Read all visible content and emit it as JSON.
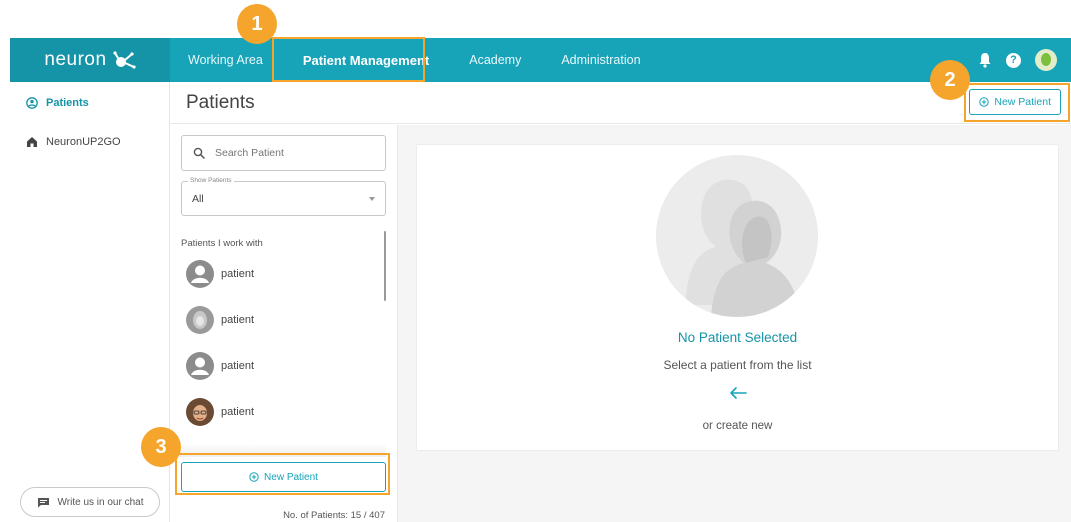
{
  "brand": {
    "logo_text": "neuron"
  },
  "nav": {
    "items": [
      "Working Area",
      "Patient Management",
      "Academy",
      "Administration"
    ],
    "active": "Patient Management"
  },
  "top_icons": [
    "bell-icon",
    "help-icon",
    "user-avatar"
  ],
  "help_glyph": "?",
  "sidebar": {
    "items": [
      {
        "label": "Patients",
        "icon": "user-circle-icon",
        "active": true
      },
      {
        "label": "NeuronUP2GO",
        "icon": "home-icon",
        "active": false
      }
    ],
    "chat_label": "Write us in our chat"
  },
  "header": {
    "title": "Patients",
    "new_patient_label": "New Patient"
  },
  "list": {
    "search_placeholder": "Search Patient",
    "filter_label": "Show Patients",
    "filter_value": "All",
    "heading": "Patients I work with",
    "patients": [
      {
        "name": "patient",
        "avatar": "default-avatar"
      },
      {
        "name": "patient",
        "avatar": "female-silhouette-avatar"
      },
      {
        "name": "patient",
        "avatar": "default-avatar"
      },
      {
        "name": "patient",
        "avatar": "photo-avatar"
      }
    ],
    "new_patient_label": "New Patient",
    "count_text": "No. of Patients: 15 / 407"
  },
  "empty_state": {
    "title": "No Patient Selected",
    "subtitle": "Select a patient from the list",
    "or_text": "or create new"
  },
  "callouts": [
    "1",
    "2",
    "3"
  ],
  "colors": {
    "topbar": "#17a3b8",
    "accent": "#1593a7",
    "highlight": "#f5a52b"
  }
}
